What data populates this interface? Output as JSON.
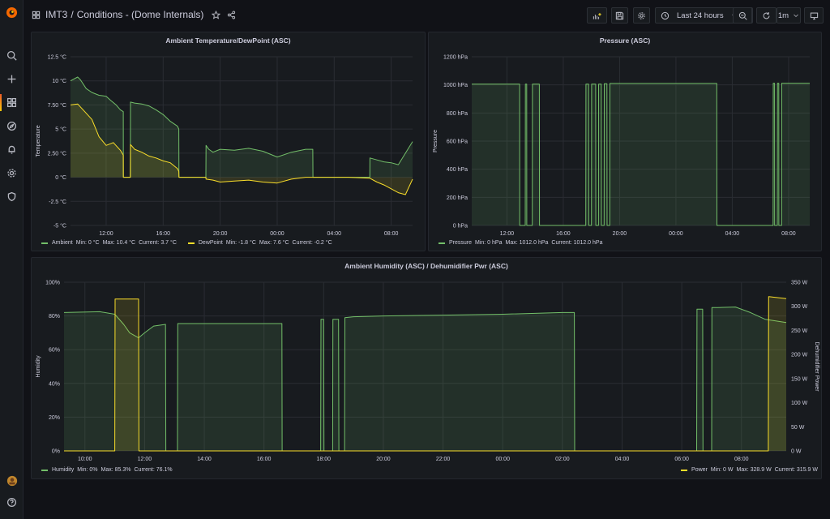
{
  "header": {
    "folder": "IMT3",
    "separator": "/",
    "dashboard_title": "Conditions - (Dome Internals)",
    "time_range": "Last 24 hours",
    "refresh_interval": "1m"
  },
  "sidebar": {
    "items": [
      "search-icon",
      "plus-icon",
      "dashboards-icon",
      "explore-icon",
      "alerting-icon",
      "configuration-icon",
      "shield-icon"
    ],
    "bottom": [
      "avatar",
      "help-icon"
    ]
  },
  "colors": {
    "series_green": "#73bf69",
    "series_yellow": "#fade2a",
    "panel_bg": "#181b1f",
    "page_bg": "#111217"
  },
  "panels": {
    "temperature": {
      "title": "Ambient Temperature/DewPoint (ASC)",
      "ylabel": "Temperature",
      "legend": [
        {
          "name": "Ambient",
          "min": "Min: 0 °C",
          "max": "Max: 10.4 °C",
          "current": "Current: 3.7 °C"
        },
        {
          "name": "DewPoint",
          "min": "Min: -1.8 °C",
          "max": "Max: 7.6 °C",
          "current": "Current: -0.2 °C"
        }
      ]
    },
    "pressure": {
      "title": "Pressure (ASC)",
      "ylabel": "Pressure",
      "legend": [
        {
          "name": "Pressure",
          "min": "Min: 0 hPa",
          "max": "Max: 1012.0 hPa",
          "current": "Current: 1012.0 hPa"
        }
      ]
    },
    "humidity": {
      "title": "Ambient Humidity (ASC) / Dehumidifier Pwr (ASC)",
      "ylabel": "Humidity",
      "ylabel_right": "Dehumidifier Power",
      "legend_left": {
        "name": "Humidity",
        "min": "Min: 0%",
        "max": "Max: 85.3%",
        "current": "Current: 76.1%"
      },
      "legend_right": {
        "name": "Power",
        "min": "Min: 0 W",
        "max": "Max: 328.9 W",
        "current": "Current: 315.9 W"
      }
    }
  },
  "chart_data": [
    {
      "id": "temperature",
      "type": "line",
      "title": "Ambient Temperature/DewPoint (ASC)",
      "ylabel": "Temperature",
      "x_ticks": [
        "12:00",
        "16:00",
        "20:00",
        "00:00",
        "04:00",
        "08:00"
      ],
      "x_range_hours": [
        9.5,
        33.5
      ],
      "y_ticks": [
        "12.5 °C",
        "10 °C",
        "7.50 °C",
        "5 °C",
        "2.50 °C",
        "0 °C",
        "-2.5 °C",
        "-5 °C"
      ],
      "ylim": [
        -5,
        12.5
      ],
      "grid": true,
      "series": [
        {
          "name": "Ambient",
          "color": "#73bf69",
          "x": [
            9.5,
            10.0,
            10.2,
            10.6,
            11.0,
            11.5,
            12.0,
            12.3,
            12.7,
            13.0,
            13.2,
            13.21,
            13.7,
            13.71,
            14.0,
            14.5,
            15.0,
            15.5,
            16.0,
            16.5,
            17.0,
            17.1,
            17.11,
            19.0,
            19.01,
            19.2,
            19.5,
            20.0,
            21.0,
            22.0,
            23.0,
            24.0,
            25.0,
            26.0,
            26.5,
            26.51,
            30.5,
            30.51,
            31.0,
            31.5,
            32.0,
            32.5,
            33.0,
            33.5
          ],
          "y": [
            10.0,
            10.4,
            10.1,
            9.2,
            8.8,
            8.5,
            8.4,
            8.0,
            7.5,
            7.0,
            6.8,
            0,
            0,
            7.8,
            7.7,
            7.6,
            7.4,
            7.0,
            6.5,
            5.8,
            5.3,
            5.0,
            0,
            0,
            3.3,
            2.9,
            2.6,
            2.9,
            2.8,
            3.0,
            2.7,
            2.1,
            2.6,
            2.9,
            2.9,
            0,
            0,
            2.0,
            1.8,
            1.6,
            1.5,
            1.3,
            2.5,
            3.7
          ]
        },
        {
          "name": "DewPoint",
          "color": "#fade2a",
          "x": [
            9.5,
            10.0,
            10.5,
            11.0,
            11.5,
            12.0,
            12.5,
            13.0,
            13.2,
            13.21,
            13.7,
            13.71,
            14.0,
            14.5,
            15.0,
            15.5,
            16.0,
            16.5,
            17.0,
            17.1,
            17.11,
            19.0,
            19.01,
            19.5,
            20.0,
            21.0,
            22.0,
            23.0,
            24.0,
            25.0,
            26.0,
            26.5,
            27.0,
            28.0,
            29.0,
            30.5,
            31.0,
            31.5,
            32.0,
            32.5,
            33.0,
            33.5
          ],
          "y": [
            7.5,
            7.6,
            6.8,
            6.0,
            4.2,
            3.3,
            3.6,
            2.8,
            2.3,
            0,
            0,
            3.4,
            2.9,
            2.6,
            2.2,
            2.0,
            1.7,
            1.5,
            0.9,
            0.6,
            0,
            0,
            -0.2,
            -0.3,
            -0.5,
            -0.4,
            -0.3,
            -0.5,
            -0.6,
            -0.2,
            0,
            0,
            0,
            0,
            0,
            -0.1,
            -0.5,
            -0.8,
            -1.2,
            -1.6,
            -1.8,
            -0.2
          ]
        }
      ]
    },
    {
      "id": "pressure",
      "type": "line",
      "title": "Pressure (ASC)",
      "ylabel": "Pressure",
      "x_ticks": [
        "12:00",
        "16:00",
        "20:00",
        "00:00",
        "04:00",
        "08:00"
      ],
      "x_range_hours": [
        9.5,
        33.5
      ],
      "y_ticks": [
        "1200 hPa",
        "1000 hPa",
        "800 hPa",
        "600 hPa",
        "400 hPa",
        "200 hPa",
        "0 hPa"
      ],
      "ylim": [
        0,
        1200
      ],
      "grid": true,
      "series": [
        {
          "name": "Pressure",
          "color": "#73bf69",
          "x": [
            9.5,
            12.9,
            12.91,
            13.3,
            13.31,
            13.4,
            13.41,
            13.8,
            13.81,
            14.3,
            14.31,
            17.6,
            17.61,
            17.8,
            17.81,
            18.0,
            18.01,
            18.3,
            18.31,
            18.5,
            18.51,
            18.7,
            18.71,
            18.9,
            18.91,
            19.1,
            19.11,
            19.3,
            19.31,
            26.9,
            26.91,
            30.9,
            30.91,
            31.0,
            31.01,
            31.2,
            31.21,
            31.3,
            31.31,
            31.5,
            31.51,
            31.7,
            31.71,
            33.5
          ],
          "y": [
            1005,
            1005,
            0,
            0,
            1005,
            1005,
            0,
            0,
            1005,
            1005,
            0,
            0,
            1005,
            1005,
            0,
            0,
            1005,
            1005,
            0,
            0,
            1005,
            1005,
            0,
            0,
            1008,
            1008,
            0,
            0,
            1010,
            1010,
            0,
            0,
            1012,
            1012,
            0,
            0,
            1012,
            1012,
            0,
            0,
            1012,
            1012,
            1012,
            1012
          ]
        }
      ]
    },
    {
      "id": "humidity",
      "type": "line",
      "title": "Ambient Humidity (ASC) / Dehumidifier Pwr (ASC)",
      "ylabel": "Humidity",
      "ylabel_right": "Dehumidifier Power",
      "x_ticks": [
        "10:00",
        "12:00",
        "14:00",
        "16:00",
        "18:00",
        "20:00",
        "22:00",
        "00:00",
        "02:00",
        "04:00",
        "06:00",
        "08:00"
      ],
      "x_range_hours": [
        9.3,
        33.5
      ],
      "y_ticks": [
        "100%",
        "80%",
        "60%",
        "40%",
        "20%",
        "0%"
      ],
      "ylim": [
        0,
        100
      ],
      "y2_ticks": [
        "350 W",
        "300 W",
        "250 W",
        "200 W",
        "150 W",
        "100 W",
        "50 W",
        "0 W"
      ],
      "y2lim": [
        0,
        350
      ],
      "grid": true,
      "series": [
        {
          "name": "Humidity",
          "color": "#73bf69",
          "axis": "left",
          "x": [
            9.3,
            10.5,
            11.0,
            11.3,
            11.5,
            11.8,
            12.0,
            12.3,
            12.7,
            12.71,
            13.1,
            13.11,
            14.0,
            15.0,
            16.0,
            16.6,
            16.61,
            17.9,
            17.91,
            18.0,
            18.01,
            18.3,
            18.31,
            18.5,
            18.51,
            18.7,
            18.71,
            19.0,
            20.0,
            22.0,
            24.0,
            26.0,
            26.4,
            26.41,
            30.5,
            30.51,
            30.7,
            30.71,
            31.0,
            31.01,
            31.2,
            31.21,
            31.8,
            32.3,
            32.8,
            33.5
          ],
          "y": [
            82,
            82.5,
            81,
            75,
            70,
            67,
            70,
            74,
            75,
            0,
            0,
            75.5,
            75.5,
            75.5,
            75.5,
            75.5,
            0,
            0,
            78,
            78,
            0,
            0,
            78,
            78,
            0,
            0,
            79,
            79.5,
            80,
            80.5,
            81,
            82,
            82,
            0,
            0,
            84,
            84,
            0,
            0,
            85,
            85,
            85,
            85.3,
            82,
            78,
            76.1
          ]
        },
        {
          "name": "Power",
          "color": "#fade2a",
          "axis": "right",
          "x": [
            9.3,
            11.0,
            11.01,
            11.8,
            11.81,
            32.9,
            32.91,
            33.5
          ],
          "y": [
            0,
            0,
            315,
            315,
            0,
            0,
            320,
            316
          ]
        }
      ]
    }
  ]
}
